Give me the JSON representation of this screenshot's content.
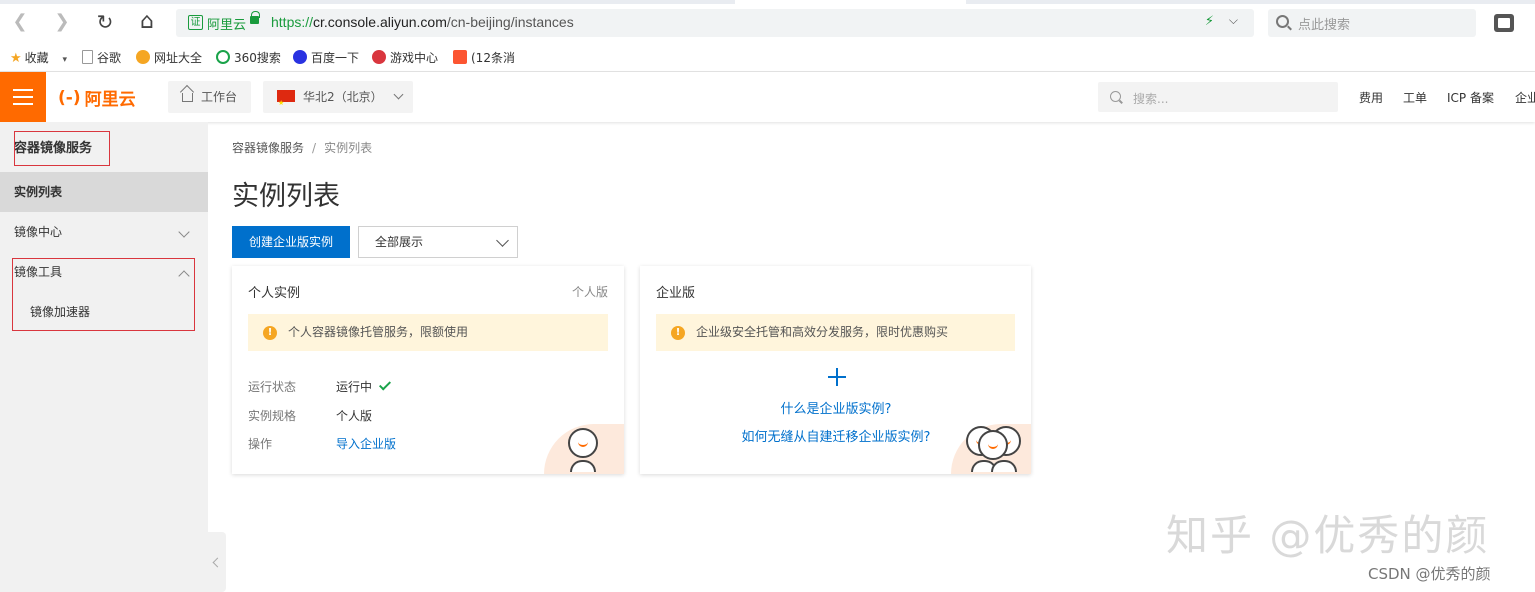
{
  "browser": {
    "back_glyph": "❮",
    "forward_glyph": "❯",
    "reload_glyph": "↻",
    "home_glyph": "⌂",
    "cert_text": "证",
    "site_name": "阿里云",
    "url_proto": "https://",
    "url_host": "cr.console.aliyun.com",
    "url_path": "/cn-beijing/instances",
    "bolt_glyph": "⚡",
    "caret_glyph": "⌵",
    "search_placeholder": "点此搜索",
    "bookmarks": [
      {
        "label": "收藏",
        "icon": "star-icon",
        "color": "#f5a623",
        "glyph": "★",
        "dropdown": "▾"
      },
      {
        "label": "谷歌",
        "icon": "page-icon",
        "color": "#999999"
      },
      {
        "label": "网址大全",
        "icon": "site-icon",
        "color": "#f5a623"
      },
      {
        "label": "360搜索",
        "icon": "360-icon",
        "color": "#1aa34a"
      },
      {
        "label": "百度一下",
        "icon": "baidu-icon",
        "color": "#2932e1"
      },
      {
        "label": "游戏中心",
        "icon": "game-icon",
        "color": "#d9363e"
      },
      {
        "label": "(12条消",
        "icon": "csdn-icon",
        "color": "#fc5531"
      }
    ]
  },
  "console": {
    "accent_color": "#ff6a00",
    "logo_mark": "(-)",
    "logo_text": "阿里云",
    "workbench_label": "工作台",
    "region_label": "华北2（北京）",
    "search_placeholder": "搜索...",
    "top_links": [
      "费用",
      "工单",
      "ICP 备案",
      "企业"
    ]
  },
  "sidebar": {
    "title": "容器镜像服务",
    "items": [
      {
        "label": "实例列表",
        "active": true
      },
      {
        "label": "镜像中心",
        "expanded": false
      },
      {
        "label": "镜像工具",
        "expanded": true
      }
    ],
    "sub_items": [
      "镜像加速器"
    ]
  },
  "main": {
    "breadcrumb": [
      "容器镜像服务",
      "实例列表"
    ],
    "breadcrumb_sep": "/",
    "title": "实例列表",
    "create_button": "创建企业版实例",
    "filter_value": "全部展示",
    "primary_color": "#0070cc"
  },
  "cards": {
    "personal": {
      "title": "个人实例",
      "tag": "个人版",
      "notice": "个人容器镜像托管服务，限额使用",
      "rows": [
        {
          "label": "运行状态",
          "value": "运行中"
        },
        {
          "label": "实例规格",
          "value": "个人版"
        },
        {
          "label": "操作",
          "value": "导入企业版"
        }
      ]
    },
    "enterprise": {
      "title": "企业版",
      "notice": "企业级安全托管和高效分发服务，限时优惠购买",
      "link1": "什么是企业版实例?",
      "link2": "如何无缝从自建迁移企业版实例?"
    },
    "warn_glyph": "!"
  },
  "overlays": {
    "watermark": "知乎 @优秀的颜",
    "csdn": "CSDN @优秀的颜"
  }
}
